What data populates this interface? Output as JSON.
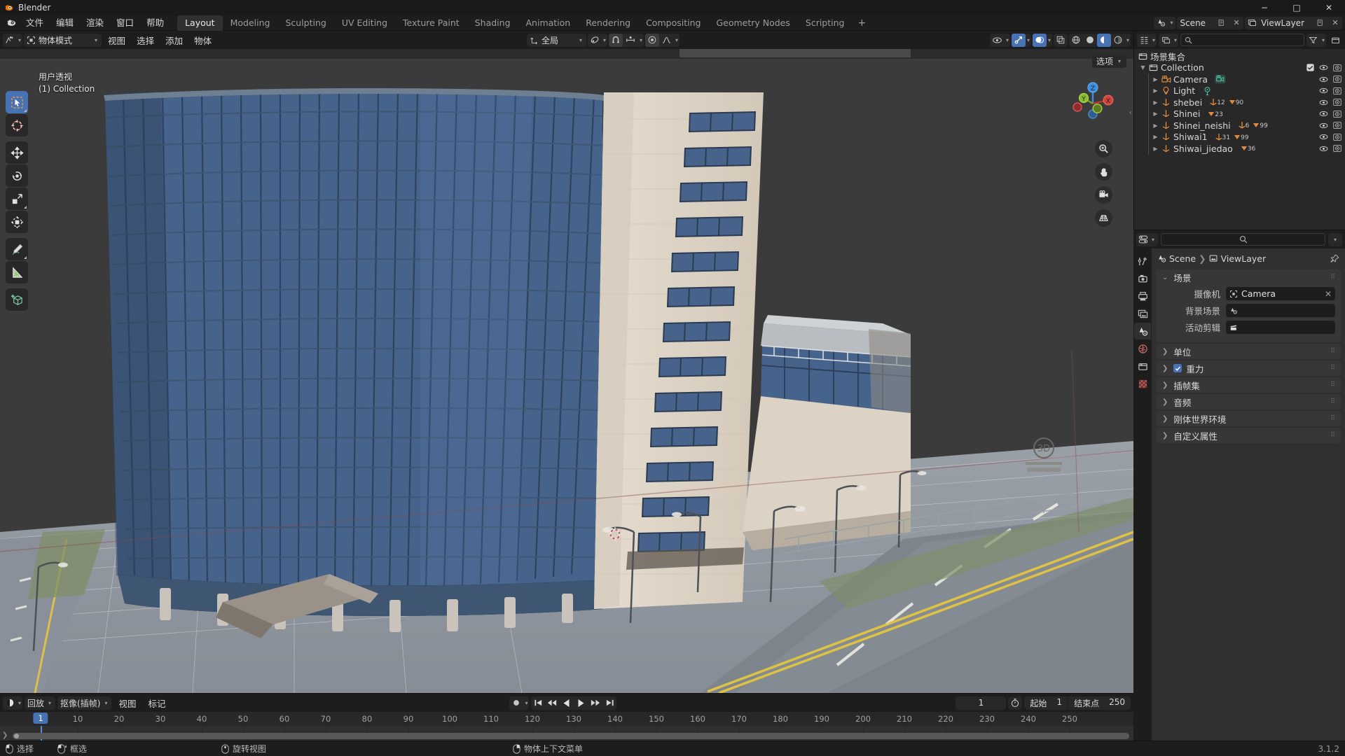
{
  "window": {
    "title": "Blender",
    "minimize_label": "−",
    "maximize_label": "□",
    "close_label": "✕"
  },
  "topbar": {
    "menus": [
      "文件",
      "编辑",
      "渲染",
      "窗口",
      "帮助"
    ],
    "workspaces": [
      {
        "label": "Layout",
        "active": true
      },
      {
        "label": "Modeling",
        "active": false
      },
      {
        "label": "Sculpting",
        "active": false
      },
      {
        "label": "UV Editing",
        "active": false
      },
      {
        "label": "Texture Paint",
        "active": false
      },
      {
        "label": "Shading",
        "active": false
      },
      {
        "label": "Animation",
        "active": false
      },
      {
        "label": "Rendering",
        "active": false
      },
      {
        "label": "Compositing",
        "active": false
      },
      {
        "label": "Geometry Nodes",
        "active": false
      },
      {
        "label": "Scripting",
        "active": false
      }
    ],
    "add_workspace_label": "+",
    "scene_name": "Scene",
    "viewlayer_name": "ViewLayer"
  },
  "viewport_header": {
    "mode": "物体模式",
    "menus": [
      "视图",
      "选择",
      "添加",
      "物体"
    ],
    "transform_orientation": "全局"
  },
  "viewport": {
    "view_label": "用户透视",
    "collection_label": "(1) Collection",
    "options_label": "选项",
    "gizmo_axes": [
      "X",
      "Y",
      "Z"
    ],
    "tools": [
      {
        "name": "tweak-select-tool",
        "active": true
      },
      {
        "name": "cursor-tool",
        "active": false
      },
      {
        "name": "move-tool",
        "active": false
      },
      {
        "name": "rotate-tool",
        "active": false
      },
      {
        "name": "scale-tool",
        "active": false
      },
      {
        "name": "transform-tool",
        "active": false
      },
      {
        "name": "annotate-tool",
        "active": false
      },
      {
        "name": "measure-tool",
        "active": false
      },
      {
        "name": "add-cube-tool",
        "active": false
      }
    ]
  },
  "timeline": {
    "editor_menus": [
      "回放",
      "抠像(插帧)",
      "视图",
      "标记"
    ],
    "current_frame": "1",
    "start_label": "起始",
    "start_value": "1",
    "end_label": "结束点",
    "end_value": "250",
    "ticks": [
      "1",
      "10",
      "20",
      "30",
      "40",
      "50",
      "60",
      "70",
      "80",
      "90",
      "100",
      "110",
      "120",
      "130",
      "140",
      "150",
      "160",
      "170",
      "180",
      "190",
      "200",
      "210",
      "220",
      "230",
      "240",
      "250"
    ],
    "playhead_label": "1"
  },
  "outliner": {
    "root_label": "场景集合",
    "collection_label": "Collection",
    "items": [
      {
        "label": "Camera",
        "type": "camera",
        "badges": []
      },
      {
        "label": "Light",
        "type": "light",
        "badges": []
      },
      {
        "label": "shebei",
        "type": "empty",
        "badges": [
          {
            "icon": "empty-axes",
            "count": "12"
          },
          {
            "icon": "mesh-data",
            "count": "90"
          }
        ]
      },
      {
        "label": "Shinei",
        "type": "empty",
        "badges": [
          {
            "icon": "mesh-data",
            "count": "23"
          }
        ]
      },
      {
        "label": "Shinei_neishi",
        "type": "empty",
        "badges": [
          {
            "icon": "empty-axes",
            "count": "6"
          },
          {
            "icon": "mesh-data",
            "count": "99"
          }
        ]
      },
      {
        "label": "Shiwai1",
        "type": "empty",
        "badges": [
          {
            "icon": "empty-axes",
            "count": "31"
          },
          {
            "icon": "mesh-data",
            "count": "99"
          }
        ]
      },
      {
        "label": "Shiwai_jiedao",
        "type": "empty",
        "badges": [
          {
            "icon": "mesh-data",
            "count": "36"
          }
        ]
      }
    ]
  },
  "properties": {
    "breadcrumb": [
      "Scene",
      "ViewLayer"
    ],
    "scene_panel": {
      "title": "场景",
      "rows": [
        {
          "label": "摄像机",
          "value": "Camera",
          "icon": "camera-data",
          "clearable": true
        },
        {
          "label": "背景场景",
          "value": "",
          "icon": "scene-data",
          "clearable": false
        },
        {
          "label": "活动剪辑",
          "value": "",
          "icon": "clip-data",
          "clearable": false
        }
      ]
    },
    "collapsed_panels": [
      {
        "label": "单位",
        "checkbox": false
      },
      {
        "label": "重力",
        "checkbox": true
      },
      {
        "label": "插帧集",
        "checkbox": false
      },
      {
        "label": "音频",
        "checkbox": false
      },
      {
        "label": "刚体世界环境",
        "checkbox": false
      },
      {
        "label": "自定义属性",
        "checkbox": false
      }
    ],
    "tabs": [
      {
        "name": "tool",
        "active": false
      },
      {
        "name": "render",
        "active": false
      },
      {
        "name": "output",
        "active": false
      },
      {
        "name": "view-layer",
        "active": false
      },
      {
        "name": "scene",
        "active": true
      },
      {
        "name": "world",
        "active": false
      },
      {
        "name": "collection",
        "active": false
      },
      {
        "name": "texture",
        "active": false
      }
    ]
  },
  "statusbar": {
    "hints": [
      {
        "mouse": "left",
        "label": "选择"
      },
      {
        "mouse": "left-drag",
        "label": "框选"
      },
      {
        "mouse": "middle",
        "label": "旋转视图"
      },
      {
        "mouse": "right",
        "label": "物体上下文菜单"
      }
    ],
    "version": "3.1.2"
  },
  "colors": {
    "accent": "#4772b3",
    "glass": "#4a6b94",
    "facade": "#ddd3c5",
    "ground": "#8e949c",
    "sky": "#3b3b3b"
  }
}
